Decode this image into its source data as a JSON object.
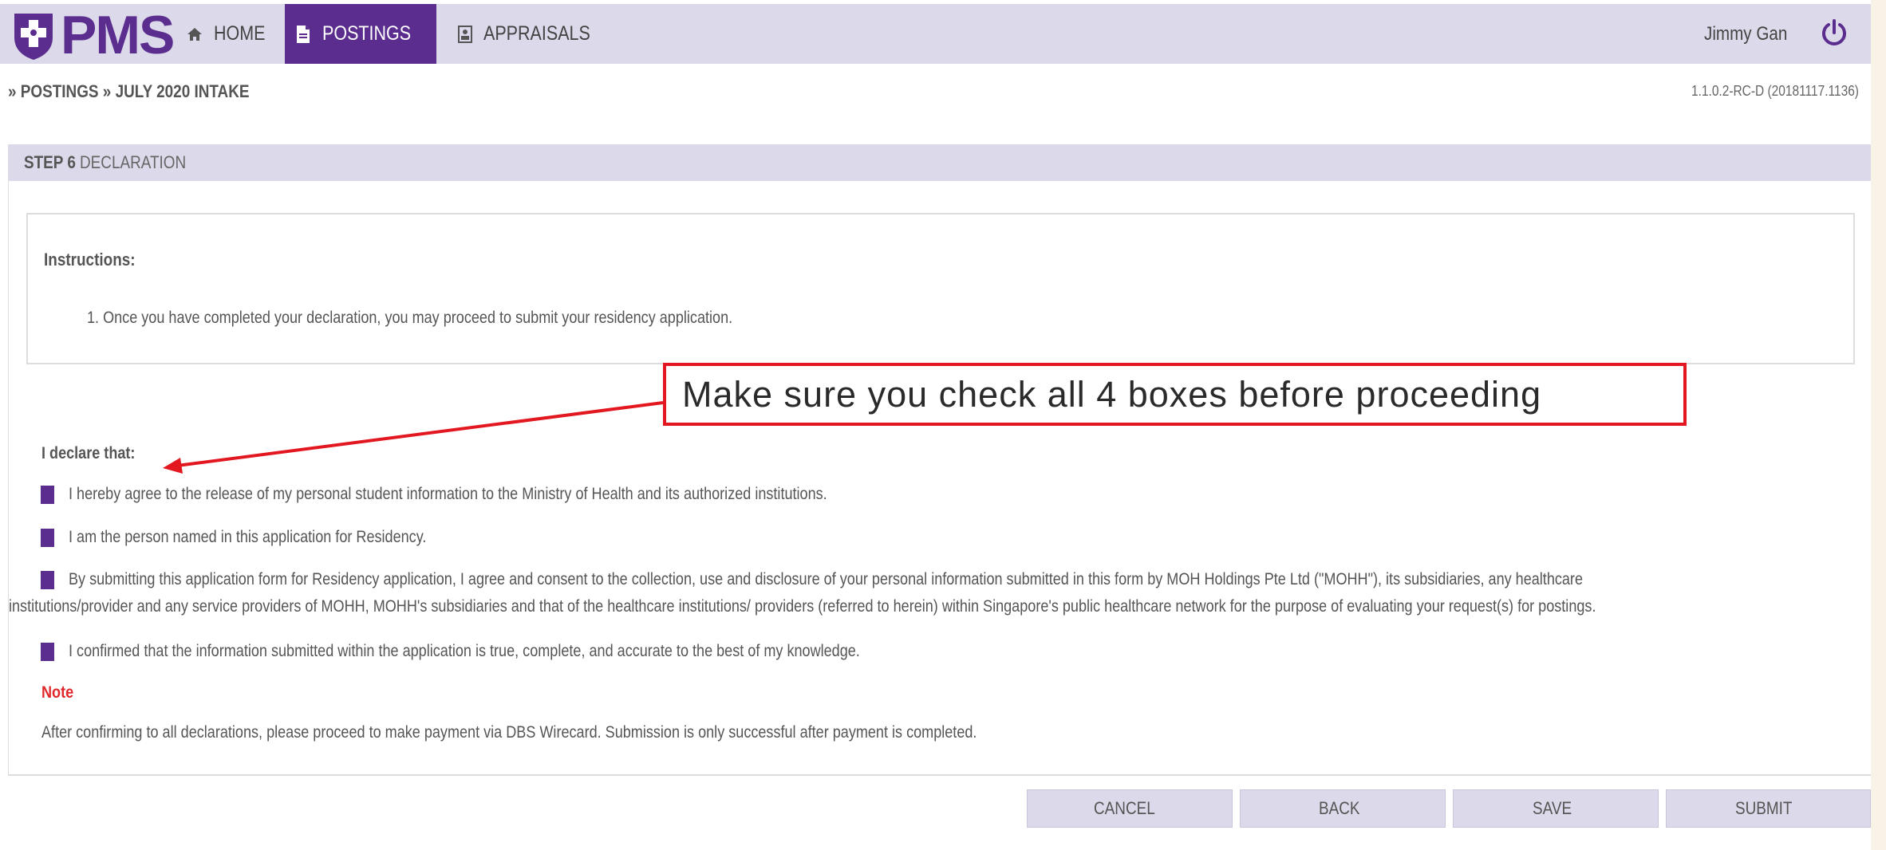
{
  "app": {
    "brand": "PMS",
    "user_name": "Jimmy Gan",
    "version": "1.1.0.2-RC-D (20181117.1136)"
  },
  "nav": {
    "home": "HOME",
    "postings": "POSTINGS",
    "appraisals": "APPRAISALS"
  },
  "breadcrumb": "» POSTINGS » JULY 2020 INTAKE",
  "step": {
    "number": "STEP 6",
    "title": "DECLARATION"
  },
  "instructions": {
    "title": "Instructions:",
    "items": [
      "1. Once you have completed your declaration, you may proceed to submit your residency application."
    ]
  },
  "declaration": {
    "title": "I declare that:",
    "items": [
      "I hereby agree to the release of my personal student information to the Ministry of Health and its authorized institutions.",
      "I am the person named in this application for Residency.",
      "By submitting this application form for Residency application, I agree and consent to the collection, use and disclosure of your personal information submitted in this form by MOH Holdings Pte Ltd (\"MOHH\"), its subsidiaries, any healthcare",
      "institutions/provider and any service providers of MOHH, MOHH's subsidiaries and that of the healthcare institutions/ providers (referred to herein) within Singapore's public healthcare network for the purpose of evaluating your request(s) for postings.",
      "I confirmed that the information submitted within the application is true, complete, and accurate to the best of my knowledge."
    ]
  },
  "note": {
    "label": "Note",
    "text": "After confirming to all declarations, please proceed to make payment via DBS Wirecard. Submission is only successful after payment is completed."
  },
  "buttons": {
    "cancel": "CANCEL",
    "back": "BACK",
    "save": "SAVE",
    "submit": "SUBMIT"
  },
  "annotation": {
    "text": "Make sure you check all 4 boxes before proceeding",
    "color": "#e3171f"
  },
  "colors": {
    "brand_purple": "#5b2d8e",
    "nav_bg": "#dcd9ea",
    "note_red": "#e0282c"
  },
  "icons": {
    "home": "home-icon",
    "postings": "document-icon",
    "appraisals": "id-card-icon",
    "logout": "power-icon"
  }
}
